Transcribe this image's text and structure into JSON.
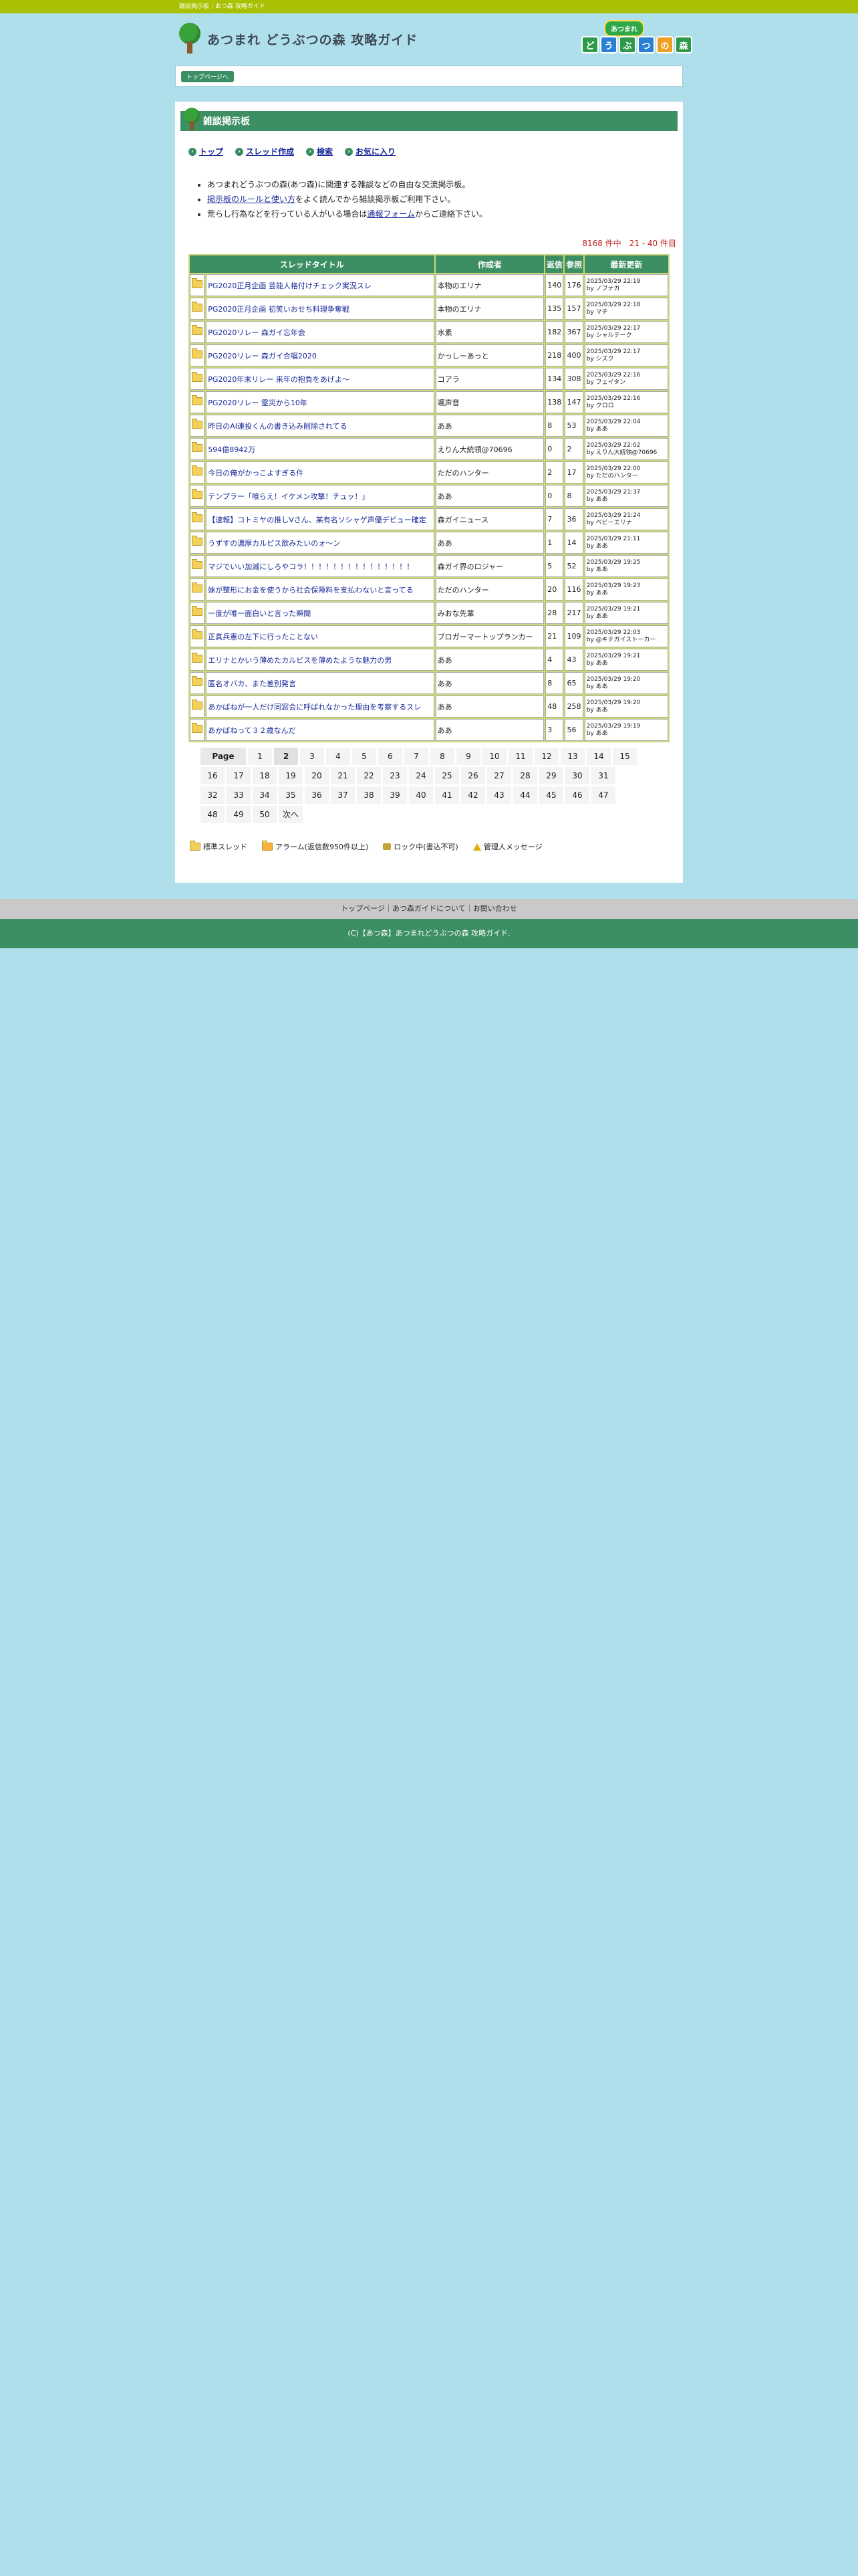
{
  "topbar": {
    "text": "雑談掲示板｜あつ森 攻略ガイド"
  },
  "header": {
    "logo_text": "あつまれ どうぶつの森 攻略ガイド",
    "logo_right_top": "あつまれ",
    "logo_right_tiles": [
      "ど",
      "う",
      "ぶ",
      "つ",
      "の",
      "森"
    ]
  },
  "nav": {
    "top_page": "トップページへ"
  },
  "board": {
    "title": "雑談掲示板",
    "menu": [
      "トップ",
      "スレッド作成",
      "検索",
      "お気に入り"
    ],
    "notes": {
      "n1": "あつまれどうぶつの森(あつ森)に関連する雑談などの自由な交流掲示板。",
      "n2_link": "掲示板のルールと使い方",
      "n2_rest": "をよく読んでから雑談掲示板ご利用下さい。",
      "n3_pre": "荒らし行為などを行っている人がいる場合は",
      "n3_link": "通報フォーム",
      "n3_post": "からご連絡下さい。"
    },
    "count": "8168 件中　21 - 40 件目",
    "columns": [
      "スレッドタイトル",
      "作成者",
      "返信",
      "参照",
      "最新更新"
    ]
  },
  "threads": [
    {
      "title": "PG2020正月企画 芸能人格付けチェック実況スレ",
      "author": "本物のエリナ",
      "replies": "140",
      "views": "176",
      "date": "2025/03/29 22:19",
      "by": "by ノブナガ"
    },
    {
      "title": "PG2020正月企画 初笑いおせち料理争奪戦",
      "author": "本物のエリナ",
      "replies": "135",
      "views": "157",
      "date": "2025/03/29 22:18",
      "by": "by マチ"
    },
    {
      "title": "PG2020リレー 森ガイ忘年会",
      "author": "水素",
      "replies": "182",
      "views": "367",
      "date": "2025/03/29 22:17",
      "by": "by シャルテーク"
    },
    {
      "title": "PG2020リレー 森ガイ合唱2020",
      "author": "かっしーあっと",
      "replies": "218",
      "views": "400",
      "date": "2025/03/29 22:17",
      "by": "by シズク"
    },
    {
      "title": "PG2020年末リレー 来年の抱負をあげよ〜",
      "author": "コアラ",
      "replies": "134",
      "views": "308",
      "date": "2025/03/29 22:16",
      "by": "by フェイタン"
    },
    {
      "title": "PG2020リレー 霊災から10年",
      "author": "颯声音",
      "replies": "138",
      "views": "147",
      "date": "2025/03/29 22:16",
      "by": "by クロロ"
    },
    {
      "title": "昨日のAI連投くんの書き込み削除されてる",
      "author": "ああ",
      "replies": "8",
      "views": "53",
      "date": "2025/03/29 22:04",
      "by": "by ああ"
    },
    {
      "title": "594億8942万",
      "author": "えりん大統領@70696",
      "replies": "0",
      "views": "2",
      "date": "2025/03/29 22:02",
      "by": "by えりん大統領@70696"
    },
    {
      "title": "今日の俺がかっこよすぎる件",
      "author": "ただのハンター",
      "replies": "2",
      "views": "17",
      "date": "2025/03/29 22:00",
      "by": "by ただのハンター"
    },
    {
      "title": "テンプラー「喰らえ！イケメン攻撃！チュッ！」",
      "author": "ああ",
      "replies": "0",
      "views": "8",
      "date": "2025/03/29 21:37",
      "by": "by ああ"
    },
    {
      "title": "【速報】コトミヤの推しVさん、某有名ソシャゲ声優デビュー確定",
      "author": "森ガイニュース",
      "replies": "7",
      "views": "36",
      "date": "2025/03/29 21:24",
      "by": "by ベビーエリナ"
    },
    {
      "title": "うずすの濃厚カルピス飲みたいのォ〜ン",
      "author": "ああ",
      "replies": "1",
      "views": "14",
      "date": "2025/03/29 21:11",
      "by": "by ああ"
    },
    {
      "title": "マジでいい加減にしろやコラ！！！！！！！！！！！！！！！",
      "author": "森ガイ界のロジャー",
      "replies": "5",
      "views": "52",
      "date": "2025/03/29 19:25",
      "by": "by ああ"
    },
    {
      "title": "妹が整形にお金を使うから社会保障料を支払わないと言ってる",
      "author": "ただのハンター",
      "replies": "20",
      "views": "116",
      "date": "2025/03/29 19:23",
      "by": "by ああ"
    },
    {
      "title": "一度が唯一面白いと言った瞬間",
      "author": "みおな先輩",
      "replies": "28",
      "views": "217",
      "date": "2025/03/29 19:21",
      "by": "by ああ"
    },
    {
      "title": "正真兵憲の左下に行ったことない",
      "author": "ブロガーマートップランカー",
      "replies": "21",
      "views": "109",
      "date": "2025/03/29 22:03",
      "by": "by @キチガイストーカー"
    },
    {
      "title": "エリナとかいう薄めたカルピスを薄めたような魅力の男",
      "author": "ああ",
      "replies": "4",
      "views": "43",
      "date": "2025/03/29 19:21",
      "by": "by ああ"
    },
    {
      "title": "匿名オバカ、また差別発言",
      "author": "ああ",
      "replies": "8",
      "views": "65",
      "date": "2025/03/29 19:20",
      "by": "by ああ"
    },
    {
      "title": "あかばねが一人だけ同窓会に呼ばれなかった理由を考察するスレ",
      "author": "ああ",
      "replies": "48",
      "views": "258",
      "date": "2025/03/29 19:20",
      "by": "by ああ"
    },
    {
      "title": "あかばねって３２歳なんだ",
      "author": "ああ",
      "replies": "3",
      "views": "56",
      "date": "2025/03/29 19:19",
      "by": "by ああ"
    }
  ],
  "pager": {
    "label": "Page",
    "pages": [
      "1",
      "2",
      "3",
      "4",
      "5",
      "6",
      "7",
      "8",
      "9",
      "10",
      "11",
      "12",
      "13",
      "14",
      "15",
      "16",
      "17",
      "18",
      "19",
      "20",
      "21",
      "22",
      "23",
      "24",
      "25",
      "26",
      "27",
      "28",
      "29",
      "30",
      "31",
      "32",
      "33",
      "34",
      "35",
      "36",
      "37",
      "38",
      "39",
      "40",
      "41",
      "42",
      "43",
      "44",
      "45",
      "46",
      "47",
      "48",
      "49",
      "50"
    ],
    "next": "次へ",
    "current": "2"
  },
  "legend": {
    "normal": "標準スレッド",
    "alarm": "アラーム(返信数950件以上)",
    "locked": "ロック中(書込不可)",
    "admin": "管理人メッセージ"
  },
  "footer": {
    "links": "トップページ｜あつ森ガイドについて｜お問い合わせ",
    "copy": "(C)【あつ森】あつまれどうぶつの森 攻略ガイド."
  },
  "colors": {
    "accent": "#3c8e63",
    "topbar": "#a9c102",
    "background": "#b0dfec"
  }
}
